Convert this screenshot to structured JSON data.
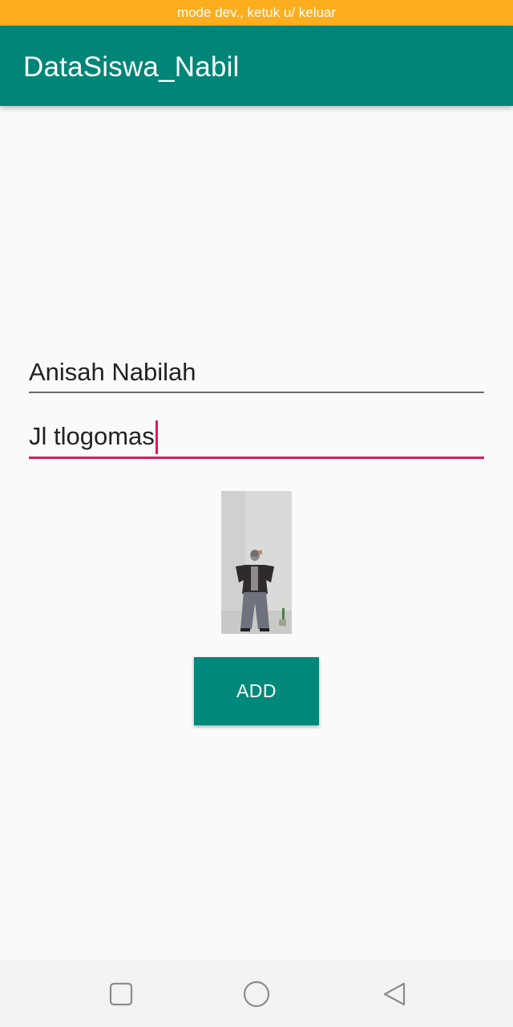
{
  "status_banner": {
    "text": "mode dev., ketuk u/ keluar"
  },
  "app_bar": {
    "title": "DataSiswa_Nabil"
  },
  "form": {
    "name_value": "Anisah Nabilah",
    "address_value": "Jl tlogomas"
  },
  "photo": {
    "icon": "student-photo"
  },
  "add_button": {
    "label": "ADD"
  },
  "nav_bar": {
    "recents_icon": "square-icon",
    "home_icon": "circle-icon",
    "back_icon": "triangle-back-icon"
  },
  "colors": {
    "banner": "#fcae1e",
    "primary": "#008577",
    "accent": "#d81b60",
    "button": "#00897b"
  }
}
